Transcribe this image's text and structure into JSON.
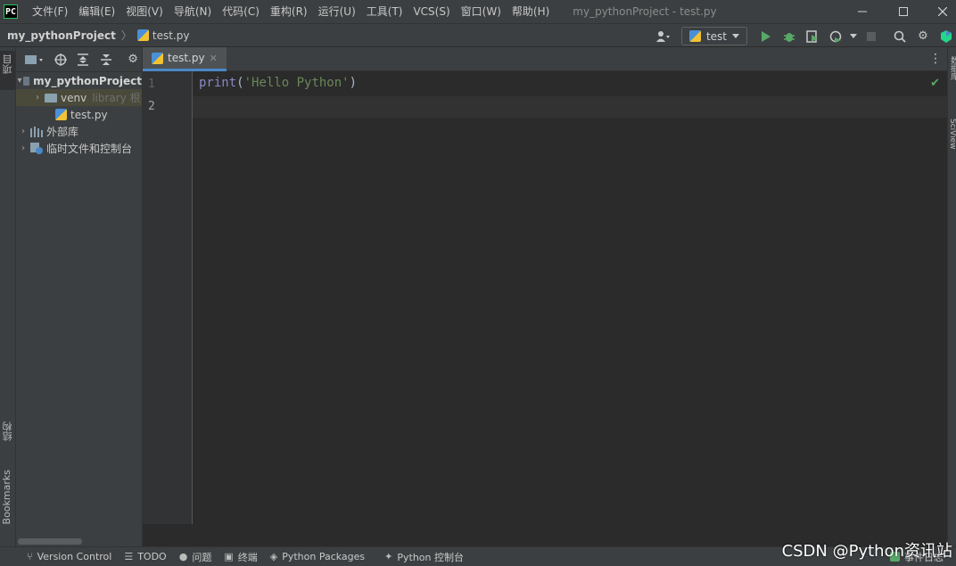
{
  "titlebar": {
    "menus": [
      "文件(F)",
      "编辑(E)",
      "视图(V)",
      "导航(N)",
      "代码(C)",
      "重构(R)",
      "运行(U)",
      "工具(T)",
      "VCS(S)",
      "窗口(W)",
      "帮助(H)"
    ],
    "window_title": "my_pythonProject - test.py"
  },
  "navbar": {
    "project": "my_pythonProject",
    "separator": "〉",
    "file": "test.py",
    "run_config": "test"
  },
  "left_stripe": {
    "project_label": "项目",
    "structure_label": "结构",
    "bookmarks_label": "Bookmarks"
  },
  "project_tree": {
    "root": "my_pythonProject",
    "venv": "venv",
    "venv_hint": "library 根",
    "file": "test.py",
    "external_libs": "外部库",
    "scratches": "临时文件和控制台"
  },
  "editor": {
    "tab_label": "test.py",
    "line_numbers": [
      "1",
      "2"
    ],
    "code": {
      "fn": "print",
      "open": "(",
      "str": "'Hello Python'",
      "close": ")"
    }
  },
  "right_stripe": {
    "db_label": "数据库",
    "sciview_label": "SciView"
  },
  "bottombar": {
    "version_control": "Version Control",
    "todo": "TODO",
    "problems": "问题",
    "terminal": "终端",
    "python_packages": "Python Packages",
    "python_console": "Python 控制台",
    "event_log": "事件日志"
  },
  "watermark": "CSDN @Python资讯站",
  "colors": {
    "background": "#2b2b2b",
    "panel": "#3c3f41",
    "accent": "#4a88c7",
    "string": "#6a8759",
    "builtin": "#8888c6",
    "run_green": "#59a869"
  }
}
